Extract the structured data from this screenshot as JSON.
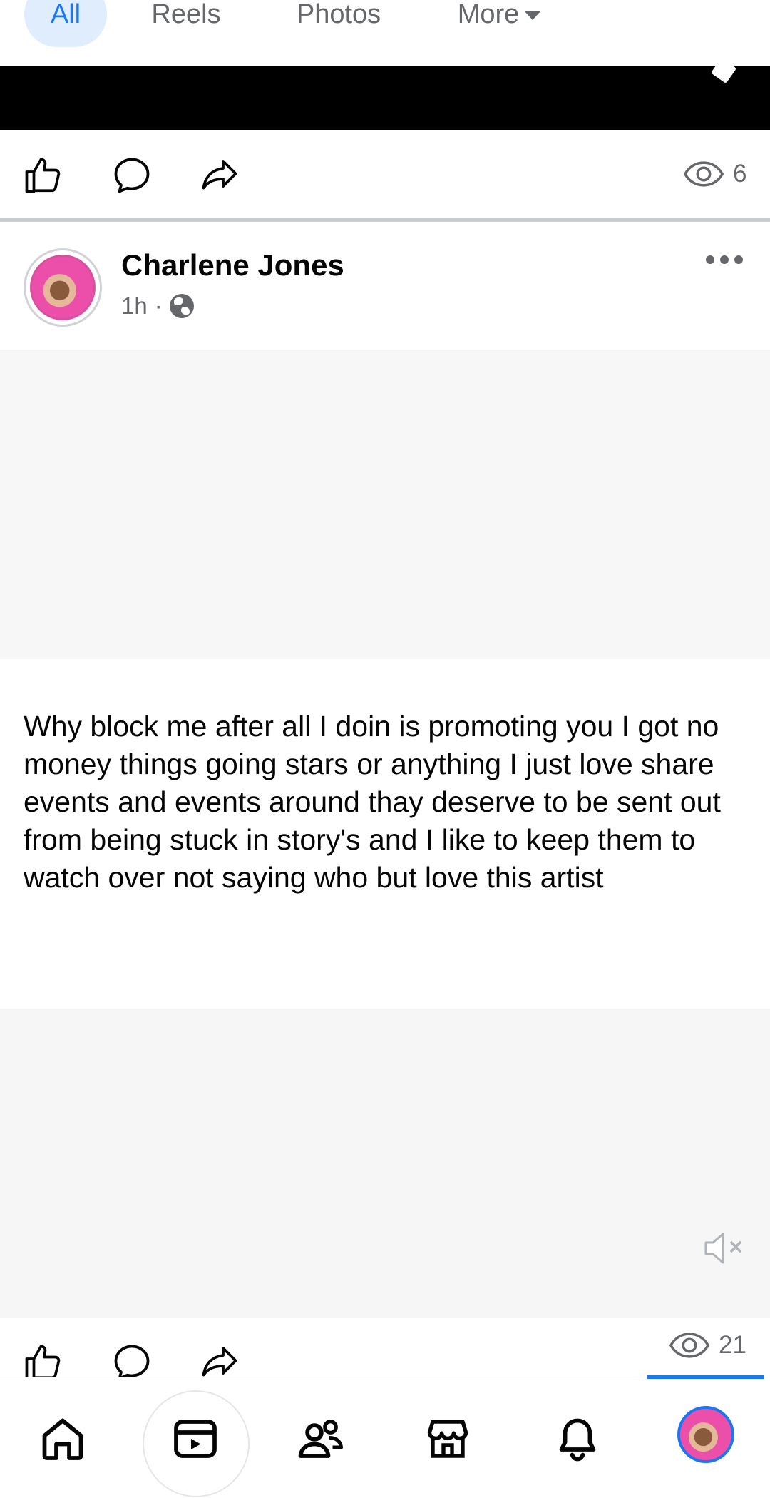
{
  "filter_tabs": {
    "all": "All",
    "reels": "Reels",
    "photos": "Photos",
    "more": "More"
  },
  "previous_post": {
    "view_count": "6"
  },
  "post": {
    "author": "Charlene Jones",
    "time": "1h",
    "separator": "·",
    "privacy_icon": "globe-icon",
    "text": "Why block me after all I doin is promoting you I got no money things going stars or anything I just love share events and events around thay deserve to be sent out from being stuck in story's and I like to keep them to watch over not saying who but love this artist",
    "view_count": "21",
    "audio_state": "muted"
  },
  "bottom_nav": {
    "items": [
      "home-icon",
      "video-icon",
      "friends-icon",
      "marketplace-icon",
      "notifications-icon",
      "profile-avatar"
    ],
    "active": "profile-avatar",
    "accent": "#1877f2"
  },
  "colors": {
    "accent": "#1877f2",
    "active_tab_bg": "#e0edfc",
    "secondary_text": "#65676b"
  }
}
